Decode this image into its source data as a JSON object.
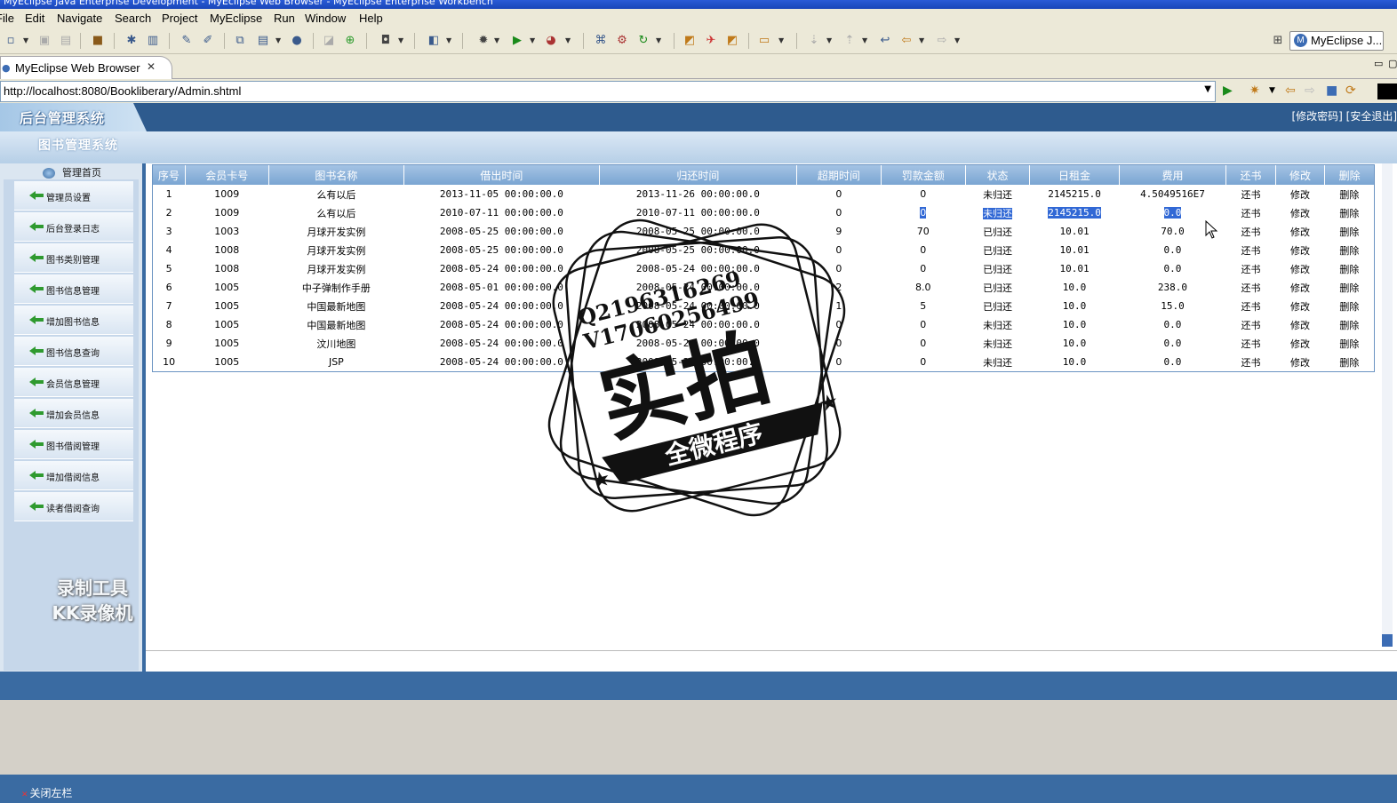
{
  "window": {
    "title": "MyEclipse Java Enterprise Development - MyEclipse Web Browser - MyEclipse Enterprise Workbench"
  },
  "menu": [
    "File",
    "Edit",
    "Navigate",
    "Search",
    "Project",
    "MyEclipse",
    "Run",
    "Window",
    "Help"
  ],
  "perspective": {
    "label": "MyEclipse J..."
  },
  "tab": {
    "label": "MyEclipse Web Browser"
  },
  "url": {
    "value": "http://localhost:8080/Bookliberary/Admin.shtml"
  },
  "app": {
    "logo": "后台管理系统",
    "header_links": "[修改密码] [安全退出]",
    "subtitle": "图书管理系统",
    "home": "管理首页",
    "footer": "关闭左栏"
  },
  "sidebar": {
    "items": [
      "管理员设置",
      "后台登录日志",
      "图书类别管理",
      "图书信息管理",
      "增加图书信息",
      "图书信息查询",
      "会员信息管理",
      "增加会员信息",
      "图书借阅管理",
      "增加借阅信息",
      "读者借阅查询"
    ]
  },
  "table": {
    "headers": [
      "序号",
      "会员卡号",
      "图书名称",
      "借出时间",
      "归还时间",
      "超期时间",
      "罚款金额",
      "状态",
      "日租金",
      "费用",
      "还书",
      "修改",
      "删除"
    ],
    "rows": [
      [
        "1",
        "1009",
        "么有以后",
        "2013-11-05 00:00:00.0",
        "2013-11-26 00:00:00.0",
        "0",
        "0",
        "未归还",
        "2145215.0",
        "4.5049516E7",
        "还书",
        "修改",
        "删除"
      ],
      [
        "2",
        "1009",
        "么有以后",
        "2010-07-11 00:00:00.0",
        "2010-07-11 00:00:00.0",
        "0",
        "0",
        "未归还",
        "2145215.0",
        "0.0",
        "还书",
        "修改",
        "删除"
      ],
      [
        "3",
        "1003",
        "月球开发实例",
        "2008-05-25 00:00:00.0",
        "2008-05-25 00:00:00.0",
        "9",
        "70",
        "已归还",
        "10.01",
        "70.0",
        "还书",
        "修改",
        "删除"
      ],
      [
        "4",
        "1008",
        "月球开发实例",
        "2008-05-25 00:00:00.0",
        "2008-05-25 00:00:00.0",
        "0",
        "0",
        "已归还",
        "10.01",
        "0.0",
        "还书",
        "修改",
        "删除"
      ],
      [
        "5",
        "1008",
        "月球开发实例",
        "2008-05-24 00:00:00.0",
        "2008-05-24 00:00:00.0",
        "0",
        "0",
        "已归还",
        "10.01",
        "0.0",
        "还书",
        "修改",
        "删除"
      ],
      [
        "6",
        "1005",
        "中子弹制作手册",
        "2008-05-01 00:00:00.0",
        "2008-05-24 00:00:00.0",
        "2",
        "8.0",
        "已归还",
        "10.0",
        "238.0",
        "还书",
        "修改",
        "删除"
      ],
      [
        "7",
        "1005",
        "中国最新地图",
        "2008-05-24 00:00:00.0",
        "2008-05-24 00:00:00.0",
        "1",
        "5",
        "已归还",
        "10.0",
        "15.0",
        "还书",
        "修改",
        "删除"
      ],
      [
        "8",
        "1005",
        "中国最新地图",
        "2008-05-24 00:00:00.0",
        "2008-05-24 00:00:00.0",
        "0",
        "0",
        "未归还",
        "10.0",
        "0.0",
        "还书",
        "修改",
        "删除"
      ],
      [
        "9",
        "1005",
        "汶川地图",
        "2008-05-24 00:00:00.0",
        "2008-05-24 00:00:00.0",
        "0",
        "0",
        "未归还",
        "10.0",
        "0.0",
        "还书",
        "修改",
        "删除"
      ],
      [
        "10",
        "1005",
        "JSP",
        "2008-05-24 00:00:00.0",
        "2008-05-24 00:00:00.0",
        "0",
        "0",
        "未归还",
        "10.0",
        "0.0",
        "还书",
        "修改",
        "删除"
      ]
    ],
    "highlighted_row": 2
  },
  "watermarks": {
    "recorder_line1": "录制工具",
    "recorder_line2": "KK录像机",
    "stamp_main": "实拍",
    "stamp_banner": "全微程序",
    "stamp_line1": "Q2196316269",
    "stamp_line2": "V17060256499"
  },
  "colors": {
    "app_blue": "#3a6ba2",
    "header_blue": "#2e5b8e",
    "selection": "#3168d5"
  }
}
